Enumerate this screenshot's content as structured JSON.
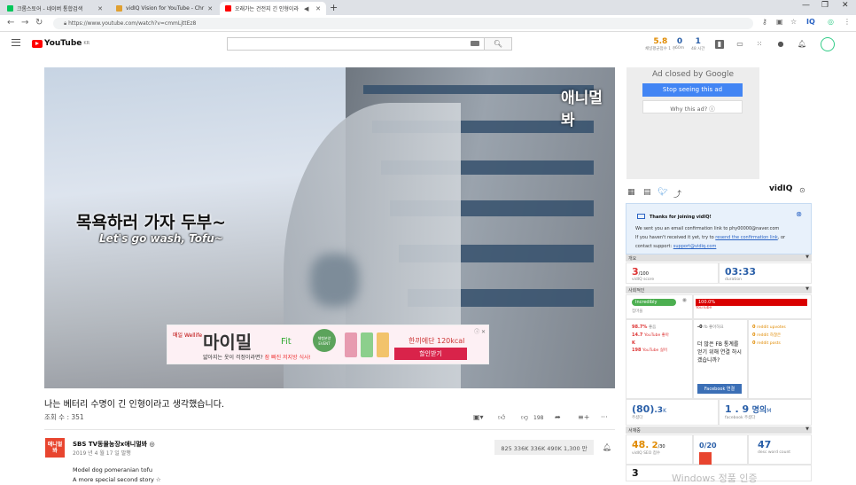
{
  "browser": {
    "tabs": [
      {
        "label": "크롬스토어 - 네이버 통합검색"
      },
      {
        "label": "vidIQ Vision for YouTube - Chr"
      },
      {
        "label": "오래가는 건전지 긴 인형이라"
      }
    ],
    "url": "https://www.youtube.com/watch?v=cmmLjttEz8"
  },
  "youtube": {
    "logo_text": "YouTube",
    "logo_region": "KR",
    "search_placeholder": "",
    "stats": [
      {
        "value": "5.8",
        "label": "채널평균점수 1 주"
      },
      {
        "value": "0",
        "label": "60m"
      },
      {
        "value": "1",
        "label": "48 시간"
      }
    ]
  },
  "video": {
    "channel_watermark": "애니멀봐",
    "subtitle_ko": "목욕하러 가자 두부~",
    "subtitle_en": "Let's go wash, Tofu~",
    "ad": {
      "brand": "매일 Wellife",
      "product": "마이밀",
      "fit": "Fit",
      "event_badge": "체험분양 EVENT",
      "tagline": "얇아지는 옷이 걱정이라면?",
      "tagline_highlight": "잠 빠진 저지방 식사!",
      "kcal": "한끼에단 120kcal",
      "cta": "할인받기"
    },
    "title": "나는 베터리 수명이 긴 인형이라고 생각했습니다.",
    "views": "조회 수 : 351",
    "dislike_count": "198",
    "channel": {
      "avatar_text": "애니멀봐",
      "name": "SBS TV동물농장x애니멀봐 ◎",
      "published": "2019 년 4 월 17 일 발행",
      "subscribe_label": "825 336K 336K 490K 1,300 만",
      "description": [
        "Model dog pomeranian tofu",
        "A more special second story ☆"
      ]
    }
  },
  "ad_panel": {
    "closed_by": "Ad closed by Google",
    "stop_label": "Stop seeing this ad",
    "why_label": "Why this ad? ⓘ"
  },
  "vidiq": {
    "logo": "vidIQ",
    "notice": {
      "title": "Thanks for joining vidIQ!",
      "line1": "We sent you an email confirmation link to phy00000@naver.com",
      "line2": "If you haven't received it yet, try to",
      "resend": "resend the confirmation link",
      "line2b": ", or",
      "line3": "contact support:",
      "support": "support@vidiq.com"
    },
    "overview": {
      "header": "개요",
      "score": "3",
      "score_max": "/100",
      "score_label": "vidIQ score",
      "duration": "03:33",
      "duration_label": "duration"
    },
    "social": {
      "header": "사회적인",
      "badge": "Incredibly",
      "badge_sub": "집마을",
      "yt_pct": "100.0%",
      "yt_label": "YouTube",
      "pct1": "98.7%",
      "pct1_label": "좋음",
      "v1": "14.7",
      "v1_label": "YouTube 좋아",
      "v1_unit": "K",
      "v2": "198",
      "v2_label": "YouTube 싫어",
      "fb_likes": "-0",
      "fb_likes_label": "fb 좋아하요",
      "reddit_upvotes": "reddit upvotes",
      "reddit_downvotes": "reddit 하찮은",
      "reddit_posts": "reddit posts",
      "zero": "0",
      "fb_prompt": "더 많은 FB 통계를 얻기 위해 연결 하시겠습니까?",
      "fb_button": "Facebook 연결",
      "comments": "(80)",
      "comments_k": ".3",
      "comments_unit": "K",
      "comments_label": "주셨다",
      "fb_shares": "1 . 9",
      "fb_shares_unit": "명의",
      "fb_shares_m": "M",
      "fb_shares_label": "facebook 주셨다"
    },
    "seo": {
      "header": "서재중",
      "score": "48",
      "score_dec": ". 2",
      "score_max": "/30",
      "score_label": "vidIQ SEO 점수",
      "title_score": "0/20",
      "desc_count": "47",
      "desc_label": "desc word count",
      "row2": "3"
    }
  },
  "os": {
    "watermark": "Windows 정품 인증"
  }
}
